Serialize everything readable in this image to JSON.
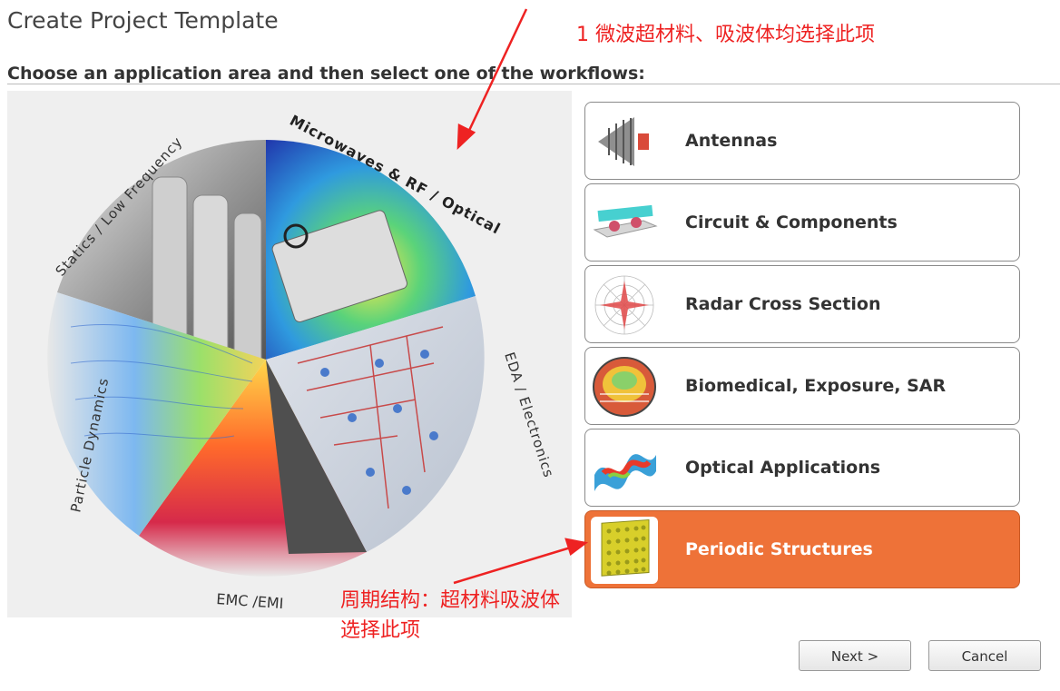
{
  "dialog": {
    "title": "Create Project Template",
    "subtitle": "Choose an application area and then select one of the workflows:"
  },
  "wheel": {
    "segments": [
      {
        "label": "Statics / Low Frequency"
      },
      {
        "label": "Microwaves & RF / Optical"
      },
      {
        "label": "EDA / Electronics"
      },
      {
        "label": "EMC / EMI"
      },
      {
        "label": "Particle Dynamics"
      }
    ],
    "display_labels": {
      "statics": "Statics / Low Frequency",
      "microwaves": "Microwaves & RF / Optical",
      "eda": "EDA / Electronics",
      "emc": "EMC /EMI",
      "particle": "Particle Dynamics"
    }
  },
  "workflows": [
    {
      "label": "Antennas",
      "icon": "antenna-icon",
      "selected": false
    },
    {
      "label": "Circuit & Components",
      "icon": "circuit-icon",
      "selected": false
    },
    {
      "label": "Radar Cross Section",
      "icon": "radar-icon",
      "selected": false
    },
    {
      "label": "Biomedical, Exposure, SAR",
      "icon": "biomedical-icon",
      "selected": false
    },
    {
      "label": "Optical Applications",
      "icon": "optical-icon",
      "selected": false
    },
    {
      "label": "Periodic Structures",
      "icon": "periodic-structure-icon",
      "selected": true
    }
  ],
  "buttons": {
    "next": "Next >",
    "cancel": "Cancel"
  },
  "annotations": {
    "note1": "1 微波超材料、吸波体均选择此项",
    "note2_line1": "周期结构：超材料吸波体",
    "note2_line2": "选择此项"
  },
  "colors": {
    "accent": "#ee7238",
    "annotation": "#ee2222"
  }
}
